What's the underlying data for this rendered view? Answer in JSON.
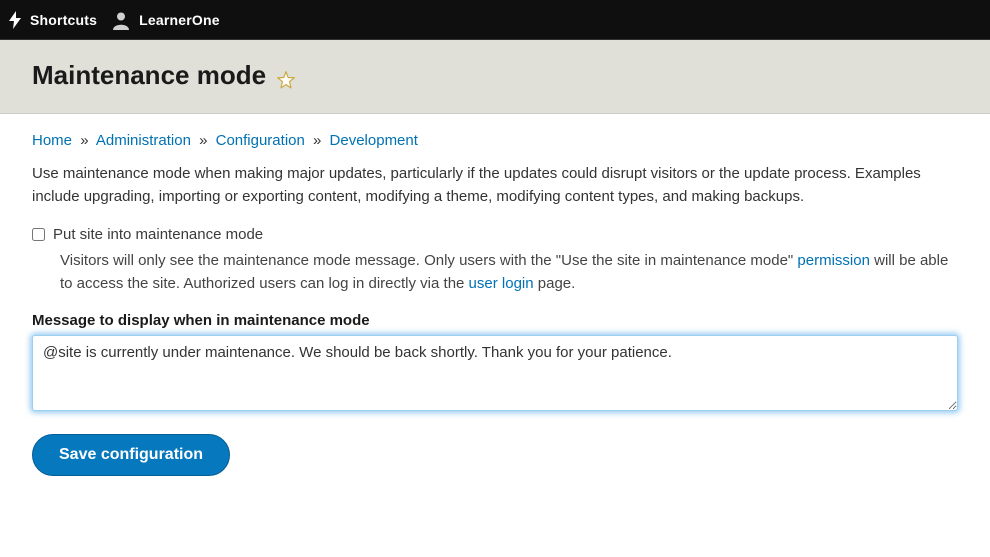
{
  "toolbar": {
    "shortcuts_label": "Shortcuts",
    "username": "LearnerOne"
  },
  "header": {
    "title": "Maintenance mode"
  },
  "breadcrumb": {
    "items": [
      "Home",
      "Administration",
      "Configuration",
      "Development"
    ],
    "separator": "»"
  },
  "intro": "Use maintenance mode when making major updates, particularly if the updates could disrupt visitors or the update process. Examples include upgrading, importing or exporting content, modifying a theme, modifying content types, and making backups.",
  "form": {
    "maint_checkbox": {
      "checked": false,
      "label": "Put site into maintenance mode",
      "desc_prefix": "Visitors will only see the maintenance mode message. Only users with the \"Use the site in maintenance mode\" ",
      "desc_link1": "permission",
      "desc_mid": " will be able to access the site. Authorized users can log in directly via the ",
      "desc_link2": "user login",
      "desc_suffix": " page."
    },
    "message": {
      "label": "Message to display when in maintenance mode",
      "value": "@site is currently under maintenance. We should be back shortly. Thank you for your patience."
    },
    "submit_label": "Save configuration"
  }
}
